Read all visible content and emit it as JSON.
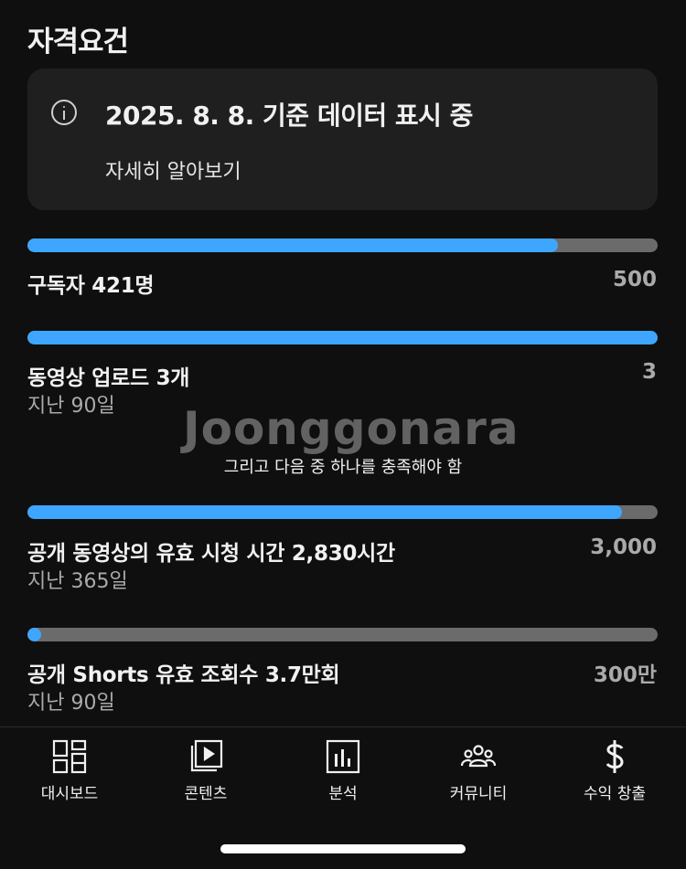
{
  "page_title": "자격요건",
  "info_card": {
    "text": "2025. 8. 8. 기준 데이터 표시 중",
    "learn_more": "자세히 알아보기"
  },
  "requirements": [
    {
      "label": "구독자 421명",
      "subtext": "",
      "target": "500",
      "progress": 0.842
    },
    {
      "label": "동영상 업로드 3개",
      "subtext": "지난 90일",
      "target": "3",
      "progress": 1.0
    },
    {
      "label": "공개 동영상의 유효 시청 시간 2,830시간",
      "subtext": "지난 365일",
      "target": "3,000",
      "progress": 0.943
    },
    {
      "label": "공개 Shorts 유효 조회수 3.7만회",
      "subtext": "지난 90일",
      "target": "300만",
      "progress": 0.012
    }
  ],
  "or_text": "그리고 다음 중 하나를 충족해야 함",
  "watermark": "Joonggonara",
  "nav": [
    {
      "label": "대시보드",
      "icon": "dashboard-icon"
    },
    {
      "label": "콘텐츠",
      "icon": "content-icon"
    },
    {
      "label": "분석",
      "icon": "analytics-icon"
    },
    {
      "label": "커뮤니티",
      "icon": "community-icon"
    },
    {
      "label": "수익 창출",
      "icon": "dollar-icon"
    }
  ],
  "colors": {
    "accent": "#3ea6ff",
    "track": "#6b6b6b",
    "background": "#0f0f0f",
    "card": "#1f1f1f"
  }
}
